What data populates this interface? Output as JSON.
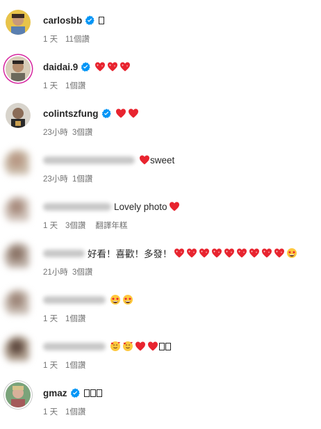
{
  "comments": [
    {
      "user": "carlosbb",
      "verified": true,
      "text": "",
      "emojis": [],
      "boxes": 1,
      "time": "1 天",
      "likes": "11個讚"
    },
    {
      "user": "daidai.9",
      "verified": true,
      "text": "",
      "emojis": [
        "sparkle-heart",
        "sparkle-heart",
        "sparkle-heart"
      ],
      "time": "1 天",
      "likes": "1個讚"
    },
    {
      "user": "colintszfung",
      "verified": true,
      "text": "",
      "emojis": [
        "red-heart",
        "red-heart"
      ],
      "time": "23小時",
      "likes": "3個讚"
    },
    {
      "user": "",
      "verified": false,
      "text": "sweet",
      "emojis_before": [
        "red-heart"
      ],
      "time": "23小時",
      "likes": "1個讚"
    },
    {
      "user": "",
      "verified": false,
      "text": "Lovely photo",
      "emojis_after": [
        "red-heart"
      ],
      "time": "1 天",
      "likes": "3個讚",
      "translate": "翻譯年糕"
    },
    {
      "user": "",
      "verified": false,
      "text": "好看！喜歡！多發！",
      "emojis_after": [
        "sparkle-heart",
        "sparkle-heart",
        "sparkle-heart",
        "sparkle-heart",
        "sparkle-heart",
        "sparkle-heart",
        "sparkle-heart",
        "sparkle-heart",
        "sparkle-heart",
        "star-struck"
      ],
      "time": "21小時",
      "likes": "3個讚"
    },
    {
      "user": "",
      "verified": false,
      "text": "",
      "emojis_after": [
        "star-struck",
        "star-struck"
      ],
      "time": "1 天",
      "likes": "1個讚"
    },
    {
      "user": "",
      "verified": false,
      "text": "",
      "emojis_after": [
        "smiling-hearts",
        "smiling-hearts",
        "red-heart",
        "red-heart"
      ],
      "boxes": 2,
      "time": "1 天",
      "likes": "1個讚"
    },
    {
      "user": "gmaz",
      "verified": true,
      "text": "",
      "emojis": [],
      "boxes": 3,
      "time": "1 天",
      "likes": "1個讚"
    }
  ],
  "colors": {
    "verified": "#0095f6",
    "heart": "#e8242f",
    "meta": "#737373"
  }
}
